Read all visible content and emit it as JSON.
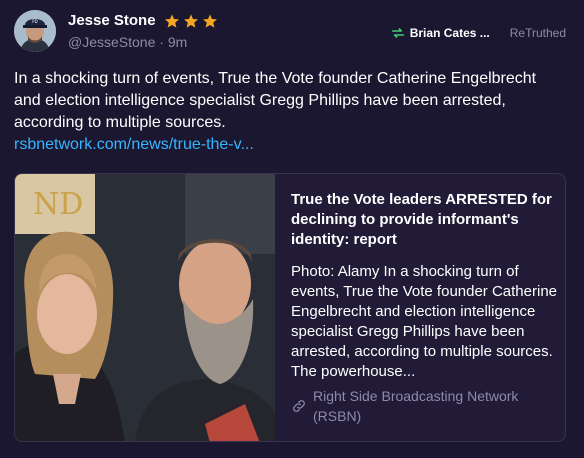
{
  "post": {
    "author": {
      "display_name": "Jesse Stone",
      "handle": "@JesseStone",
      "time": "9m",
      "separator": " · ",
      "stars": 3,
      "star_color": "#f5a623"
    },
    "retruth": {
      "user": "Brian Cates ...",
      "label": "ReTruthed",
      "icon": "retruth-icon",
      "icon_color": "#3ecf6e"
    },
    "text": "In a shocking turn of events, True the Vote founder Catherine Engelbrecht and election intelligence specialist Gregg Phillips have been arrested, according to multiple sources.",
    "link": "rsbnetwork.com/news/true-the-v...",
    "card": {
      "title": "True the Vote leaders ARRESTED for declining to provide informant's identity: report",
      "description": "Photo: Alamy In a shocking turn of events, True the Vote founder Catherine Engelbrecht and election intelligence specialist Gregg Phillips have been arrested, according to multiple sources. The powerhouse...",
      "source": "Right Side Broadcasting Network (RSBN)",
      "source_icon": "link-icon",
      "image_alt": "photo of a woman and a bearded man"
    }
  },
  "colors": {
    "background": "#1c1730",
    "link": "#35b5ff",
    "muted": "#8f8aa8"
  }
}
